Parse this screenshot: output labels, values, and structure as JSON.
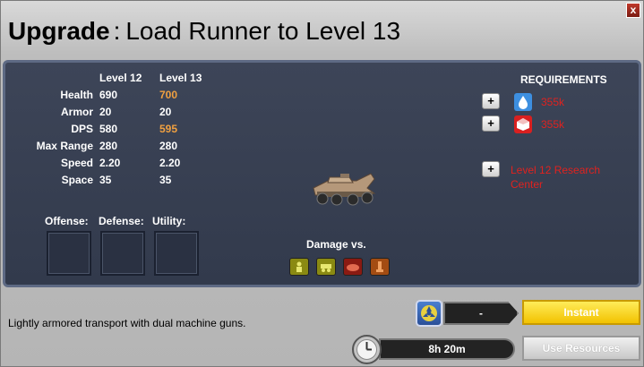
{
  "title": {
    "prefix": "Upgrade",
    "separator": ":",
    "text": "Load Runner to Level 13"
  },
  "close_label": "x",
  "stats": {
    "level_from": "Level 12",
    "level_to": "Level 13",
    "rows": [
      {
        "label": "Health",
        "from": "690",
        "to": "700",
        "improved": true
      },
      {
        "label": "Armor",
        "from": "20",
        "to": "20",
        "improved": false
      },
      {
        "label": "DPS",
        "from": "580",
        "to": "595",
        "improved": true
      },
      {
        "label": "Max Range",
        "from": "280",
        "to": "280",
        "improved": false
      },
      {
        "label": "Speed",
        "from": "2.20",
        "to": "2.20",
        "improved": false
      },
      {
        "label": "Space",
        "from": "35",
        "to": "35",
        "improved": false
      }
    ],
    "improved_color": "#f0a040"
  },
  "slots": {
    "offense": "Offense:",
    "defense": "Defense:",
    "utility": "Utility:"
  },
  "damage": {
    "title": "Damage vs.",
    "icons": [
      {
        "name": "infantry-icon",
        "color": "#8a8a12"
      },
      {
        "name": "vehicle-icon",
        "color": "#8a8a12"
      },
      {
        "name": "air-icon",
        "color": "#8a1a12"
      },
      {
        "name": "building-icon",
        "color": "#a34c12"
      }
    ]
  },
  "requirements": {
    "title": "REQUIREMENTS",
    "items": [
      {
        "icon": "water-drop-icon",
        "value": "355k"
      },
      {
        "icon": "supply-crate-icon",
        "value": "355k"
      }
    ],
    "building": "Level 12 Research Center"
  },
  "description": "Lightly armored transport with dual machine guns.",
  "cost": {
    "value": "-",
    "instant_label": "Instant"
  },
  "time": {
    "value": "8h 20m",
    "use_resources_label": "Use Resources"
  },
  "colors": {
    "requirement_text": "#e0221f",
    "instant": "#f2c200"
  }
}
